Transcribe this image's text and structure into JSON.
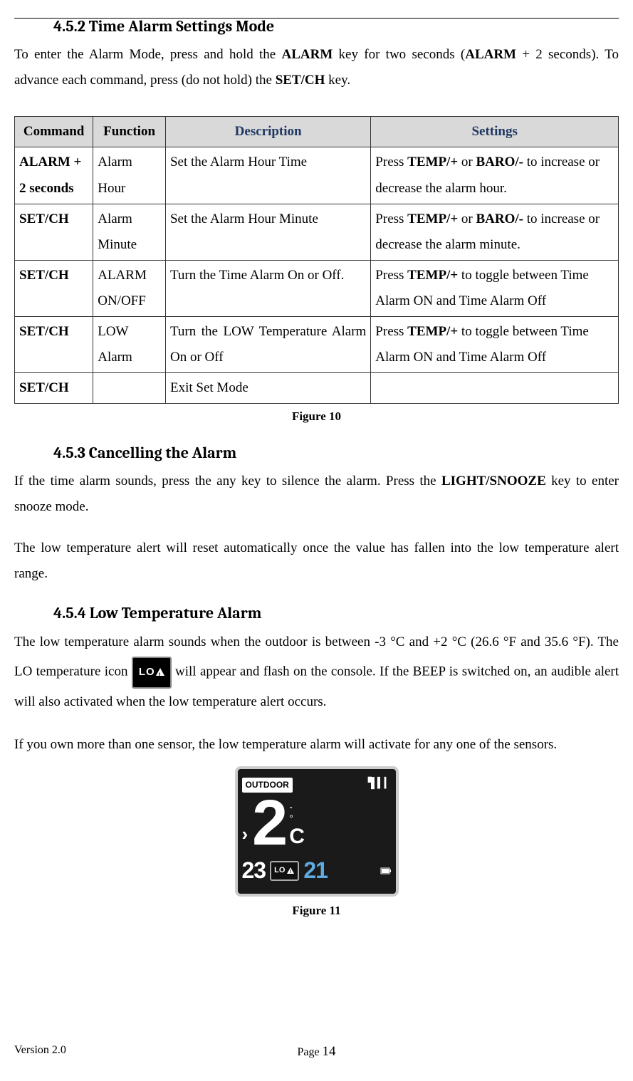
{
  "s452": {
    "heading": "4.5.2  Time Alarm Settings Mode",
    "para_a": "To enter the Alarm Mode, press and hold the ",
    "para_b": " key for two seconds (",
    "para_c": " + 2 seconds). To advance each command, press (do not hold) the ",
    "para_d": " key.",
    "key_alarm": "ALARM",
    "key_alarm2": "ALARM",
    "key_setch": "SET/CH"
  },
  "table": {
    "headers": {
      "command": "Command",
      "function": "Function",
      "description": "Description",
      "settings": "Settings"
    },
    "rows": [
      {
        "command": "ALARM + 2 seconds",
        "function": "Alarm Hour",
        "description": "Set the Alarm Hour Time",
        "settings_a": "Press ",
        "settings_b": " or ",
        "settings_c": " to increase or decrease the alarm hour.",
        "k1": "TEMP/+",
        "k2": "BARO/-"
      },
      {
        "command": "SET/CH",
        "function": "Alarm Minute",
        "description": "Set the Alarm Hour Minute",
        "settings_a": "Press ",
        "settings_b": " or ",
        "settings_c": " to increase or decrease the alarm minute.",
        "k1": "TEMP/+",
        "k2": "BARO/-"
      },
      {
        "command": "SET/CH",
        "function": "ALARM ON/OFF",
        "description": "Turn the Time Alarm On or Off.",
        "settings_a": "Press ",
        "settings_c": " to toggle between Time Alarm ON and Time Alarm Off",
        "k1": "TEMP/+"
      },
      {
        "command": "SET/CH",
        "function": "LOW Alarm",
        "description": "Turn the LOW Temperature Alarm On or Off",
        "settings_a": "Press ",
        "settings_c": " to toggle between Time Alarm ON and Time Alarm Off",
        "k1": "TEMP/+"
      },
      {
        "command": "SET/CH",
        "function": "",
        "description": "Exit Set Mode",
        "settings_a": ""
      }
    ],
    "caption": "Figure 10"
  },
  "s453": {
    "heading": "4.5.3  Cancelling the Alarm",
    "p1a": "If the time alarm sounds, press the any key to silence the alarm. Press the ",
    "p1b": " key to enter snooze mode.",
    "key_light": "LIGHT/SNOOZE",
    "p2": "The low temperature alert will reset automatically once the value has fallen into the low temperature alert range."
  },
  "s454": {
    "heading": "4.5.4  Low Temperature Alarm",
    "p1a": "The low temperature alarm sounds when the outdoor is between -3 °C and +2 °C (26.6 °F and 35.6 °F). The LO temperature icon ",
    "p1b": " will appear and flash on the console. If the BEEP is switched on, an audible alert will also activated when the low temperature alert occurs.",
    "icon_text": "LO",
    "p2": "If you own more than one sensor, the low temperature alarm will activate for any one of the sensors.",
    "caption": "Figure 11"
  },
  "display": {
    "outdoor_label": "OUTDOOR",
    "main_temp": "2",
    "unit_dot": ".",
    "unit_deg": "°",
    "unit_c": "C",
    "lo_num": "23",
    "lo_badge": "LO",
    "hi_num": "21"
  },
  "footer": {
    "version": "Version 2.0",
    "page_label": "Page ",
    "page_num": "14"
  }
}
